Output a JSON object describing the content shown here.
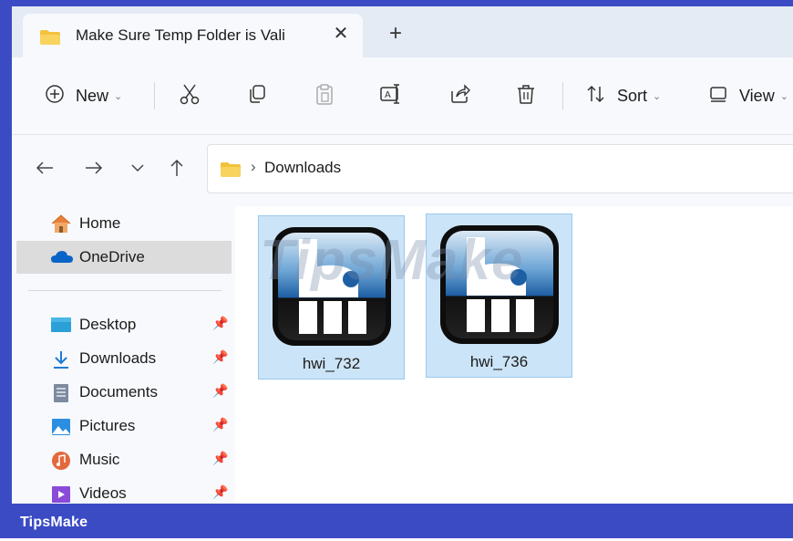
{
  "window": {
    "tab_title": "Make Sure Temp Folder is Vali",
    "close_tab_symbol": "✕",
    "new_tab_symbol": "+"
  },
  "toolbar": {
    "new_label": "New",
    "sort_label": "Sort",
    "view_label": "View",
    "chevron": "⌄"
  },
  "address": {
    "separator": "›",
    "crumb": "Downloads"
  },
  "sidebar": {
    "items": [
      {
        "label": "Home",
        "icon": "home-icon"
      },
      {
        "label": "OneDrive",
        "icon": "onedrive-icon",
        "selected": true
      },
      {
        "label": "Desktop",
        "icon": "desktop-folder-icon",
        "pinned": true
      },
      {
        "label": "Downloads",
        "icon": "download-icon",
        "pinned": true
      },
      {
        "label": "Documents",
        "icon": "documents-icon",
        "pinned": true
      },
      {
        "label": "Pictures",
        "icon": "pictures-icon",
        "pinned": true
      },
      {
        "label": "Music",
        "icon": "music-icon",
        "pinned": true
      },
      {
        "label": "Videos",
        "icon": "videos-icon",
        "pinned": true
      }
    ]
  },
  "files": [
    {
      "name": "hwi_732",
      "icon": "hwinfo-app-icon",
      "selected": true
    },
    {
      "name": "hwi_736",
      "icon": "hwinfo-app-icon",
      "selected": true
    }
  ],
  "watermark": "TipsMake",
  "footer": {
    "brand": "TipsMake"
  },
  "colors": {
    "frame": "#3b4bc4",
    "selection": "#cce4f7",
    "selection_border": "#99c9ef",
    "folder": "#f3c23c"
  }
}
